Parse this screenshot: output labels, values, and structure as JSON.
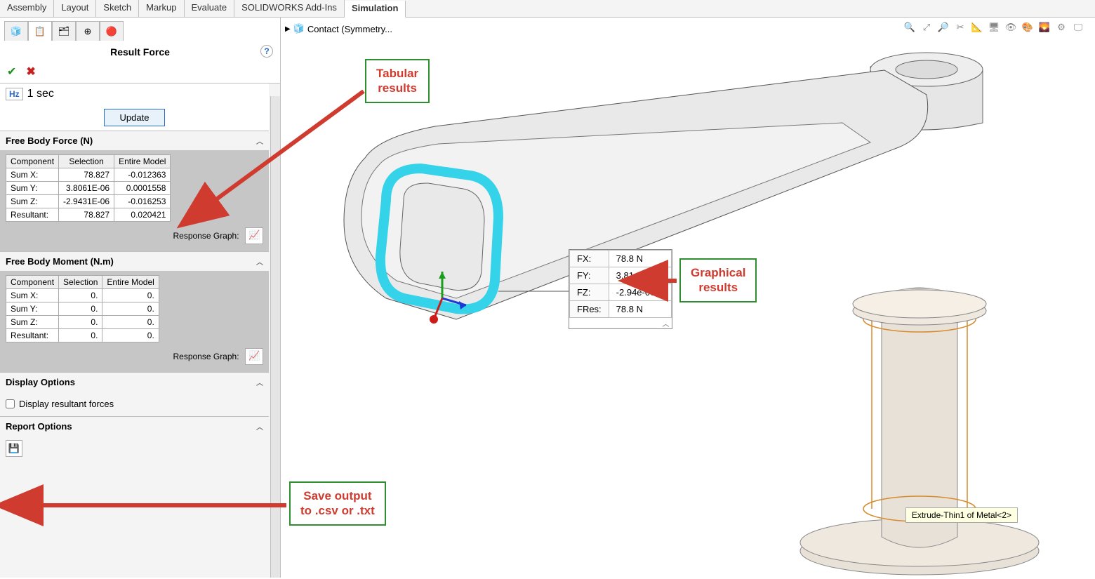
{
  "ribbon": {
    "tabs": [
      "Assembly",
      "Layout",
      "Sketch",
      "Markup",
      "Evaluate",
      "SOLIDWORKS Add-Ins",
      "Simulation"
    ],
    "active": "Simulation"
  },
  "breadcrumb": {
    "label": "Contact  (Symmetry..."
  },
  "pm": {
    "title": "Result Force",
    "time_label": "1 sec",
    "update_label": "Update",
    "force": {
      "header": "Free Body Force (N)",
      "cols": [
        "Component",
        "Selection",
        "Entire Model"
      ],
      "rows": [
        {
          "c": "Sum X:",
          "s": "78.827",
          "e": "-0.012363"
        },
        {
          "c": "Sum Y:",
          "s": "3.8061E-06",
          "e": "0.0001558"
        },
        {
          "c": "Sum Z:",
          "s": "-2.9431E-06",
          "e": "-0.016253"
        },
        {
          "c": "Resultant:",
          "s": "78.827",
          "e": "0.020421"
        }
      ],
      "resp_label": "Response Graph:"
    },
    "moment": {
      "header": "Free Body Moment (N.m)",
      "cols": [
        "Component",
        "Selection",
        "Entire Model"
      ],
      "rows": [
        {
          "c": "Sum X:",
          "s": "0.",
          "e": "0."
        },
        {
          "c": "Sum Y:",
          "s": "0.",
          "e": "0."
        },
        {
          "c": "Sum Z:",
          "s": "0.",
          "e": "0."
        },
        {
          "c": "Resultant:",
          "s": "0.",
          "e": "0."
        }
      ],
      "resp_label": "Response Graph:"
    },
    "display_options": {
      "header": "Display Options",
      "checkbox": "Display resultant forces"
    },
    "report_options": {
      "header": "Report Options"
    }
  },
  "readout": {
    "rows": [
      {
        "k": "FX:",
        "v": "78.8 N"
      },
      {
        "k": "FY:",
        "v": "3.81e-06 N"
      },
      {
        "k": "FZ:",
        "v": "-2.94e-06 N"
      },
      {
        "k": "FRes:",
        "v": "78.8 N"
      }
    ]
  },
  "callouts": {
    "tabular": "Tabular\nresults",
    "graphical": "Graphical\nresults",
    "save": "Save output\nto .csv or .txt"
  },
  "feature_tooltip": "Extrude-Thin1 of Metal<2>"
}
